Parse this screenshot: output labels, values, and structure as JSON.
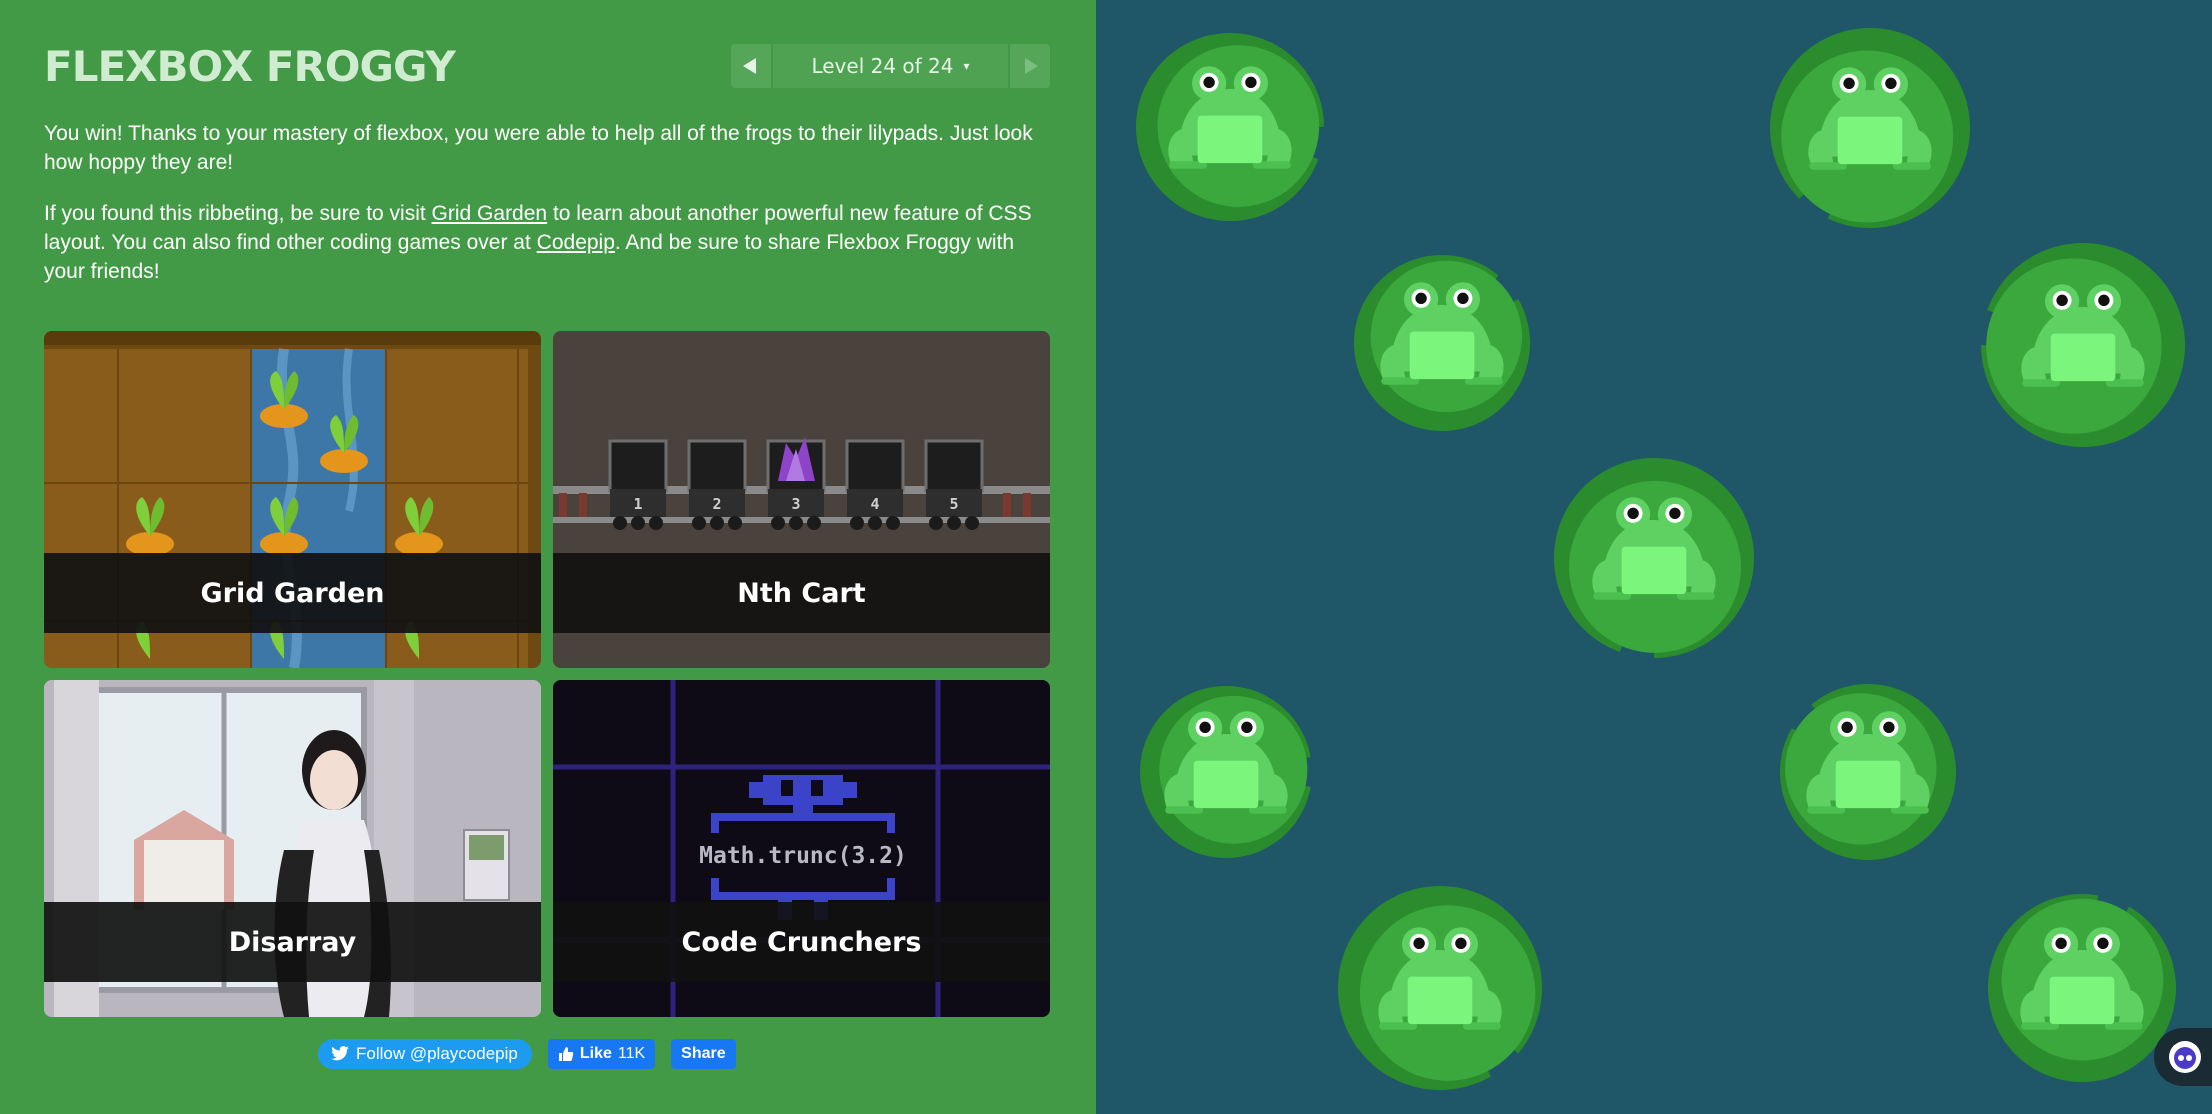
{
  "app": {
    "title": "FLEXBOX FROGGY"
  },
  "level_nav": {
    "indicator": "Level 24 of 24",
    "caret": "▾"
  },
  "intro": {
    "p1": "You win! Thanks to your mastery of flexbox, you were able to help all of the frogs to their lilypads. Just look how hoppy they are!",
    "p2_before": "If you found this ribbeting, be sure to visit ",
    "p2_link1": "Grid Garden",
    "p2_mid": " to learn about another powerful new feature of CSS layout. You can also find other coding games over at ",
    "p2_link2": "Codepip",
    "p2_after": ". And be sure to share Flexbox Froggy with your friends!"
  },
  "games": [
    {
      "name": "Grid Garden"
    },
    {
      "name": "Nth Cart"
    },
    {
      "name": "Disarray"
    },
    {
      "name": "Code Crunchers"
    }
  ],
  "nth_cart": {
    "cart_numbers": [
      "1",
      "2",
      "3",
      "4",
      "5"
    ]
  },
  "code_crunchers": {
    "code": "Math.trunc(3.2)"
  },
  "social": {
    "twitter": "Follow @playcodepip",
    "fb_like": "Like",
    "fb_count": "11K",
    "fb_share": "Share"
  },
  "colors": {
    "sidebar_bg": "#439a46",
    "pond_bg": "#1f5768",
    "lily_dark": "#2b8c2d",
    "lily_light": "#3aa83d",
    "frog": "#5ed162",
    "frog_belly": "#7bf57c"
  },
  "frogs_count": "9"
}
